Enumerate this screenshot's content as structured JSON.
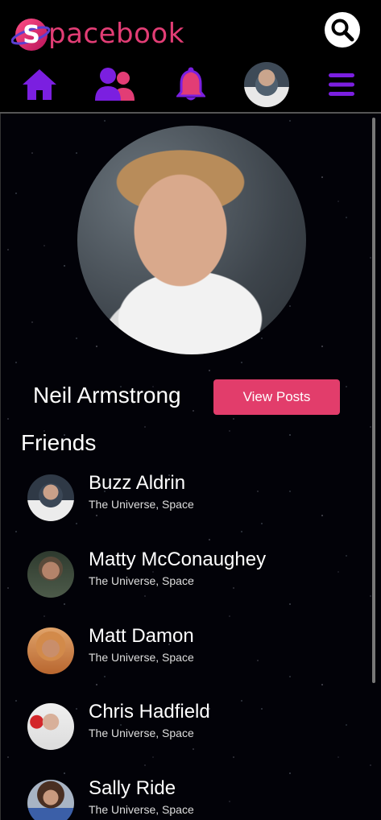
{
  "app": {
    "logo_text": "pacebook",
    "logo_letter": "S"
  },
  "nav": {
    "items": [
      {
        "name": "home",
        "icon": "home-icon"
      },
      {
        "name": "friends",
        "icon": "friends-icon"
      },
      {
        "name": "notifications",
        "icon": "bell-icon"
      },
      {
        "name": "profile",
        "icon": "avatar"
      },
      {
        "name": "menu",
        "icon": "hamburger-icon"
      }
    ]
  },
  "colors": {
    "accent_pink": "#e23d6b",
    "nav_purple": "#7b1fe0",
    "background": "#000000"
  },
  "profile": {
    "name": "Neil Armstrong",
    "view_posts_label": "View Posts"
  },
  "friends": {
    "heading": "Friends",
    "items": [
      {
        "name": "Buzz Aldrin",
        "location": "The Universe, Space"
      },
      {
        "name": "Matty McConaughey",
        "location": "The Universe, Space"
      },
      {
        "name": "Matt Damon",
        "location": "The Universe, Space"
      },
      {
        "name": "Chris Hadfield",
        "location": "The Universe, Space"
      },
      {
        "name": "Sally Ride",
        "location": "The Universe, Space"
      }
    ]
  }
}
